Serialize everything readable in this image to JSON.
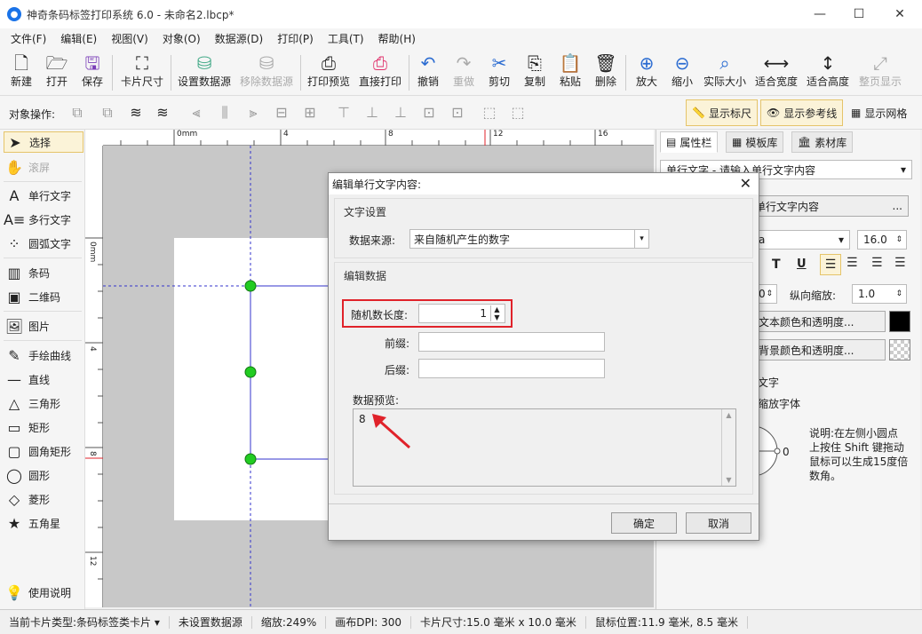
{
  "window": {
    "title": "神奇条码标签打印系统 6.0 - 未命名2.lbcp*"
  },
  "menu": [
    "文件(F)",
    "编辑(E)",
    "视图(V)",
    "对象(O)",
    "数据源(D)",
    "打印(P)",
    "工具(T)",
    "帮助(H)"
  ],
  "toolbar": {
    "new": "新建",
    "open": "打开",
    "save": "保存",
    "card_size": "卡片尺寸",
    "set_datasource": "设置数据源",
    "remove_datasource": "移除数据源",
    "print_preview": "打印预览",
    "direct_print": "直接打印",
    "undo": "撤销",
    "redo": "重做",
    "cut": "剪切",
    "copy": "复制",
    "paste": "粘贴",
    "delete": "删除",
    "zoom_in": "放大",
    "zoom_out": "缩小",
    "actual_size": "实际大小",
    "fit_width": "适合宽度",
    "fit_height": "适合高度",
    "full_page": "整页显示"
  },
  "objbar": {
    "label": "对象操作:",
    "show_ruler": "显示标尺",
    "show_guides": "显示参考线",
    "show_grid": "显示网格"
  },
  "tools": [
    "选择",
    "滚屏",
    "单行文字",
    "多行文字",
    "圆弧文字",
    "条码",
    "二维码",
    "图片",
    "手绘曲线",
    "直线",
    "三角形",
    "矩形",
    "圆角矩形",
    "圆形",
    "菱形",
    "五角星",
    "使用说明"
  ],
  "ruler": {
    "h_labels": [
      "0mm",
      "4",
      "8",
      "12",
      "16"
    ],
    "v_labels": [
      "0mm",
      "4",
      "8",
      "12"
    ]
  },
  "rightpanel": {
    "tabs": [
      "属性栏",
      "模板库",
      "素材库"
    ],
    "object_selector": "单行文字 - 请输入单行文字内容",
    "content_btn": "单行文字内容",
    "font_partial": "a",
    "font_size": "16.0",
    "vscale_label": "纵向缩放:",
    "vscale_value": "1.0",
    "hscale_partial": "0",
    "text_color_btn": "文本颜色和透明度...",
    "bg_color_btn": "背景颜色和透明度...",
    "opt1": "文字",
    "opt2": "缩放字体",
    "rotation_value": "0",
    "note": "说明:在左侧小圆点上按住 Shift 键拖动鼠标可以生成15度倍数角。"
  },
  "status": {
    "card_type": "当前卡片类型:条码标签类卡片",
    "datasource": "未设置数据源",
    "zoom": "缩放:249%",
    "dpi": "画布DPI: 300",
    "card_size": "卡片尺寸:15.0 毫米 x 10.0 毫米",
    "mouse": "鼠标位置:11.9 毫米, 8.5 毫米"
  },
  "dialog": {
    "title": "编辑单行文字内容:",
    "text_settings": "文字设置",
    "source_label": "数据来源:",
    "source_value": "来自随机产生的数字",
    "edit_data": "编辑数据",
    "length_label": "随机数长度:",
    "length_value": "1",
    "prefix_label": "前缀:",
    "suffix_label": "后缀:",
    "preview_label": "数据预览:",
    "preview_value": "8",
    "ok": "确定",
    "cancel": "取消"
  },
  "colors": {
    "highlight": "#e0222a",
    "handle": "#22cc22",
    "guide": "#3333cc"
  }
}
